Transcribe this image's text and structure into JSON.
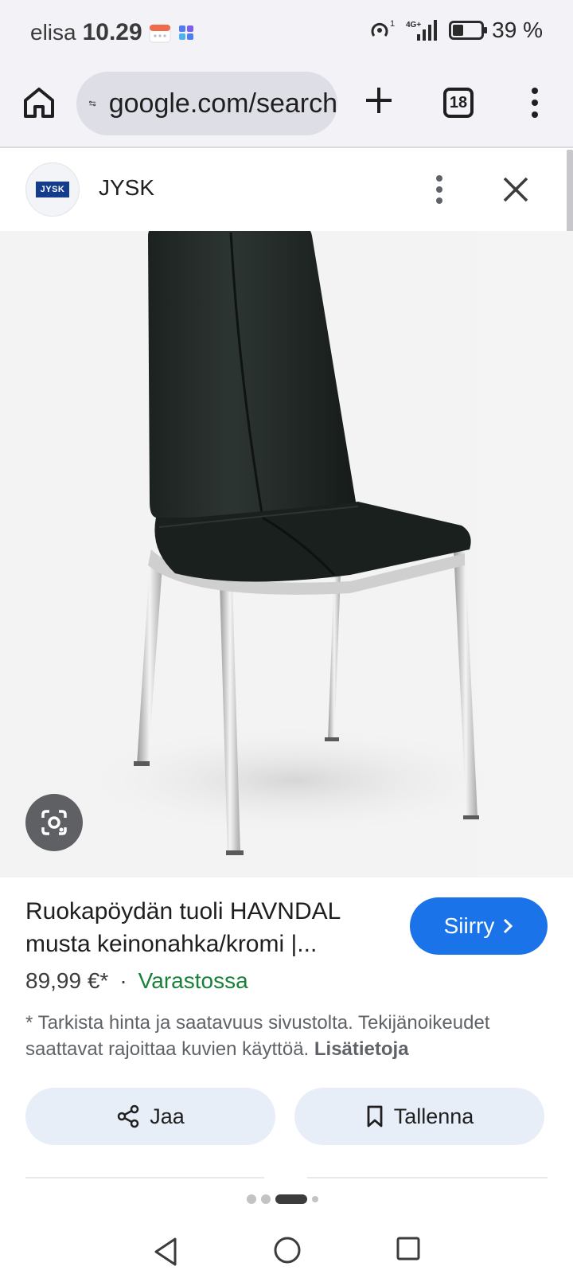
{
  "status_bar": {
    "carrier": "elisa",
    "time": "10.29",
    "network": "4G+",
    "battery_level": 0.39,
    "battery_text": "39 %",
    "icons": [
      "calendar-icon",
      "app-grid-icon",
      "hotspot-icon",
      "signal-icon",
      "battery-icon"
    ]
  },
  "browser": {
    "url": "google.com/search",
    "tab_count": "18",
    "icons": [
      "home-icon",
      "site-settings-icon",
      "plus-icon",
      "more-vert-icon"
    ]
  },
  "source": {
    "name": "JYSK",
    "logo_text": "JYSK",
    "icons": [
      "more-vert-icon",
      "close-icon"
    ]
  },
  "product": {
    "title": "Ruokapöydän tuoli HAVNDAL musta keinonahka/kromi |...",
    "go_label": "Siirry",
    "price": "89,99 €*",
    "separator": "·",
    "availability": "Varastossa",
    "disclaimer": "* Tarkista hinta ja saatavuus sivustolta. Tekijänoikeudet saattavat rajoittaa kuvien käyttöä.",
    "more_info": "Lisätietoja"
  },
  "actions": {
    "share_label": "Jaa",
    "save_label": "Tallenna"
  },
  "colors": {
    "accent": "#1a73e8",
    "stock_green": "#188038",
    "action_bg": "#e8eef8"
  }
}
